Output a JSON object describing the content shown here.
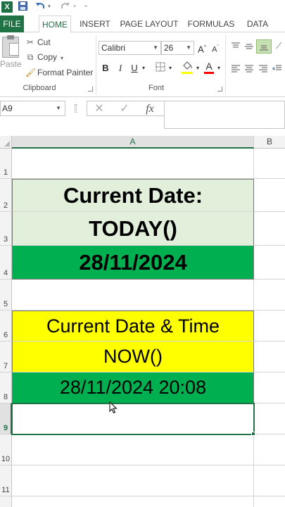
{
  "app": {
    "icon_text": "X"
  },
  "ribbon_tabs": [
    "FILE",
    "HOME",
    "INSERT",
    "PAGE LAYOUT",
    "FORMULAS",
    "DATA"
  ],
  "clipboard": {
    "paste_label": "Paste",
    "cut_label": "Cut",
    "copy_label": "Copy",
    "format_painter_label": "Format Painter",
    "group_label": "Clipboard"
  },
  "font": {
    "name": "Calibri",
    "size": "26",
    "bold_label": "B",
    "italic_label": "I",
    "underline_label": "U",
    "grow_label": "A",
    "shrink_label": "A",
    "font_color_label": "A",
    "group_label": "Font"
  },
  "formula_bar": {
    "name_box": "A9",
    "fx_label": "fx",
    "value": ""
  },
  "grid": {
    "columns": [
      "A",
      "B"
    ],
    "rows": [
      "1",
      "2",
      "3",
      "4",
      "5",
      "6",
      "7",
      "8",
      "9",
      "10",
      "11"
    ],
    "cells": {
      "A2": "Current Date:",
      "A3": "TODAY()",
      "A4": "28/11/2024",
      "A6": "Current Date & Time",
      "A7": "NOW()",
      "A8": "28/11/2024 20:08"
    },
    "selected_cell": "A9"
  },
  "colors": {
    "brand": "#217346",
    "light_green_fill": "#e2efda",
    "green_fill": "#00b050",
    "yellow_fill": "#ffff00",
    "highlight_swatch": "#ffff00",
    "font_color_swatch": "#ff0000"
  },
  "icons": {
    "excel": "excel-icon",
    "save": "save-icon",
    "undo": "undo-icon",
    "redo": "redo-icon",
    "cut": "scissors-icon",
    "copy": "copy-icon",
    "format_painter": "paintbrush-icon",
    "cancel": "x-icon",
    "enter": "checkmark-icon",
    "function": "fx-icon"
  }
}
